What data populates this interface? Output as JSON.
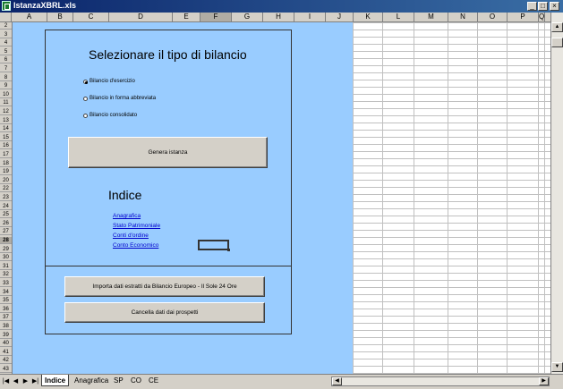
{
  "window": {
    "title": "IstanzaXBRL.xls"
  },
  "columns": [
    "A",
    "B",
    "C",
    "D",
    "E",
    "F",
    "G",
    "H",
    "I",
    "J",
    "K",
    "L",
    "M",
    "N",
    "O",
    "P",
    "Q"
  ],
  "active_column": "F",
  "rows": [
    "2",
    "3",
    "4",
    "5",
    "6",
    "7",
    "8",
    "9",
    "10",
    "11",
    "12",
    "13",
    "14",
    "15",
    "16",
    "17",
    "18",
    "19",
    "20",
    "22",
    "23",
    "24",
    "25",
    "26",
    "27",
    "28",
    "29",
    "30",
    "31",
    "32",
    "33",
    "34",
    "35",
    "36",
    "37",
    "38",
    "39",
    "40",
    "41",
    "42",
    "43"
  ],
  "active_row": "28",
  "form": {
    "heading": "Selezionare il tipo di bilancio",
    "radios": [
      {
        "label": "Bilancio d'esercizio",
        "selected": true
      },
      {
        "label": "Bilancio in forma abbreviata",
        "selected": false
      },
      {
        "label": "Bilancio consolidato",
        "selected": false
      }
    ],
    "generate_button": "Genera istanza",
    "index_heading": "Indice",
    "links": [
      "Anagrafica",
      "Stato Patrimoniale",
      "Conti d'ordine",
      "Conto Economico"
    ],
    "import_button": "Importa dati estratti da Bilancio Europeo - Il Sole 24 Ore",
    "clear_button": "Cancella dati dai prospetti"
  },
  "sheet_tabs": [
    "Indice",
    "Anagrafica",
    "SP",
    "CO",
    "CE"
  ],
  "active_tab": "Indice",
  "colors": {
    "panel": "#99ccff",
    "link": "#0000cc"
  }
}
